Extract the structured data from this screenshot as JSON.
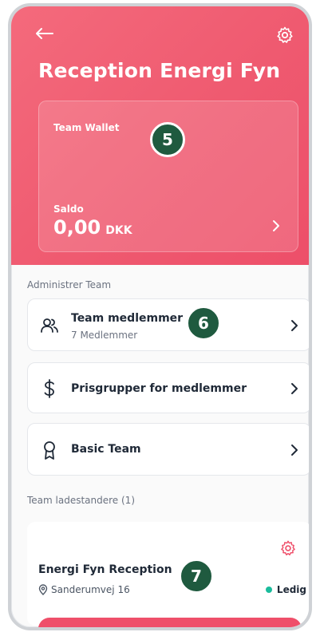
{
  "header": {
    "title": "Reception Energi Fyn",
    "back_icon": "arrow-left-icon",
    "settings_icon": "gear-icon",
    "gradient_start": "#f46a7c",
    "gradient_end": "#ed4f69"
  },
  "wallet": {
    "label": "Team Wallet",
    "saldo_label": "Saldo",
    "amount": "0,00",
    "currency": "DKK"
  },
  "sections": {
    "admin_label": "Administrer Team",
    "chargers_label": "Team ladestandere (1)"
  },
  "menu": [
    {
      "title": "Team medlemmer",
      "subtitle": "7 Medlemmer",
      "icon": "users-icon"
    },
    {
      "title": "Prisgrupper for medlemmer",
      "icon": "dollar-icon"
    },
    {
      "title": "Basic Team",
      "icon": "award-icon"
    }
  ],
  "charger": {
    "name": "Energi Fyn Reception",
    "address": "Sanderumvej 16",
    "status": "Ledig",
    "status_color": "#1abc9c"
  },
  "badges": [
    "5",
    "6",
    "7"
  ],
  "accent": "#ef4f6a",
  "badge_color": "#1f5a3f"
}
